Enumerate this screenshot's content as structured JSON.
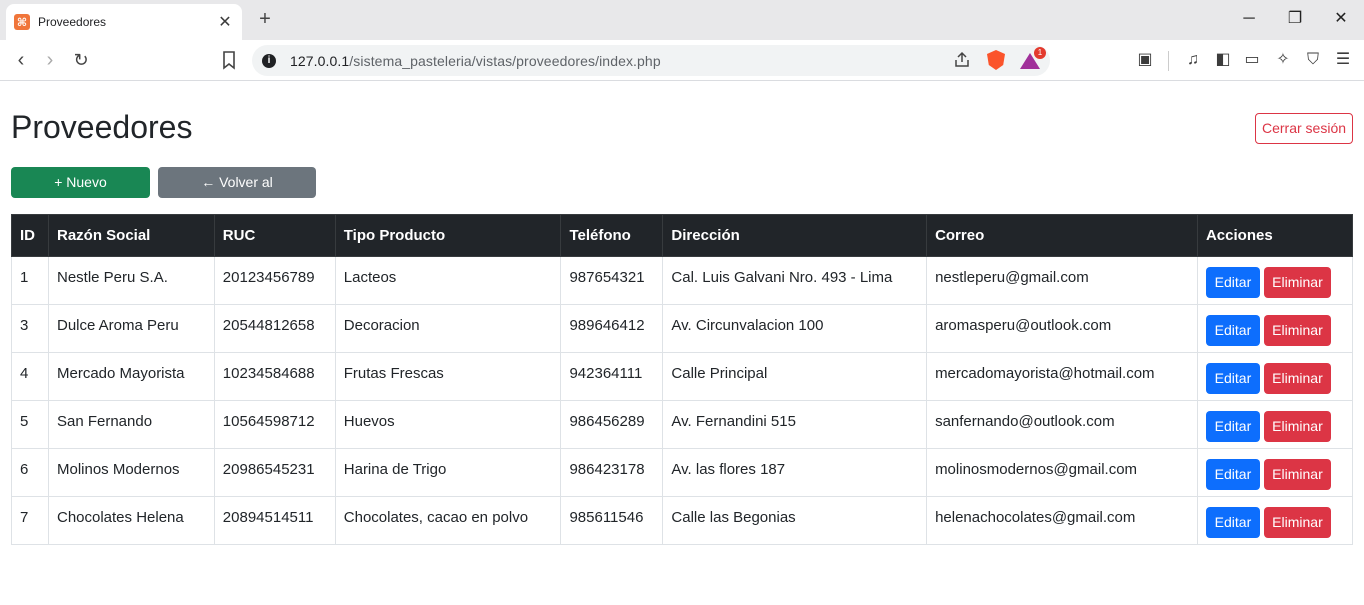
{
  "browser": {
    "tab_title": "Proveedores",
    "favicon_label": "⌘",
    "url_host": "127.0.0.1",
    "url_path": "/sistema_pasteleria/vistas/proveedores/index.php",
    "bat_badge": "1"
  },
  "page": {
    "title": "Proveedores",
    "logout_label": "Cerrar sesión",
    "new_button_label": "+ Nuevo Proveedor",
    "back_button_label": "← Volver al Dashboard"
  },
  "table": {
    "headers": [
      "ID",
      "Razón Social",
      "RUC",
      "Tipo Producto",
      "Teléfono",
      "Dirección",
      "Correo",
      "Acciones"
    ],
    "edit_label": "Editar",
    "delete_label": "Eliminar",
    "rows": [
      {
        "id": "1",
        "razon": "Nestle Peru S.A.",
        "ruc": "20123456789",
        "tipo": "Lacteos",
        "telefono": "987654321",
        "direccion": "Cal. Luis Galvani Nro. 493 - Lima",
        "correo": "nestleperu@gmail.com"
      },
      {
        "id": "3",
        "razon": "Dulce Aroma Peru",
        "ruc": "20544812658",
        "tipo": "Decoracion",
        "telefono": "989646412",
        "direccion": "Av. Circunvalacion 100",
        "correo": "aromasperu@outlook.com"
      },
      {
        "id": "4",
        "razon": "Mercado Mayorista",
        "ruc": "10234584688",
        "tipo": "Frutas Frescas",
        "telefono": "942364111",
        "direccion": "Calle Principal",
        "correo": "mercadomayorista@hotmail.com"
      },
      {
        "id": "5",
        "razon": "San Fernando",
        "ruc": "10564598712",
        "tipo": "Huevos",
        "telefono": "986456289",
        "direccion": "Av. Fernandini 515",
        "correo": "sanfernando@outlook.com"
      },
      {
        "id": "6",
        "razon": "Molinos Modernos",
        "ruc": "20986545231",
        "tipo": "Harina de Trigo",
        "telefono": "986423178",
        "direccion": "Av. las flores 187",
        "correo": "molinosmodernos@gmail.com"
      },
      {
        "id": "7",
        "razon": "Chocolates Helena",
        "ruc": "20894514511",
        "tipo": "Chocolates, cacao en polvo",
        "telefono": "985611546",
        "direccion": "Calle las Begonias",
        "correo": "helenachocolates@gmail.com"
      }
    ]
  },
  "colors": {
    "success": "#198754",
    "secondary": "#6c757d",
    "primary": "#0d6efd",
    "danger": "#dc3545",
    "dark": "#212529"
  }
}
